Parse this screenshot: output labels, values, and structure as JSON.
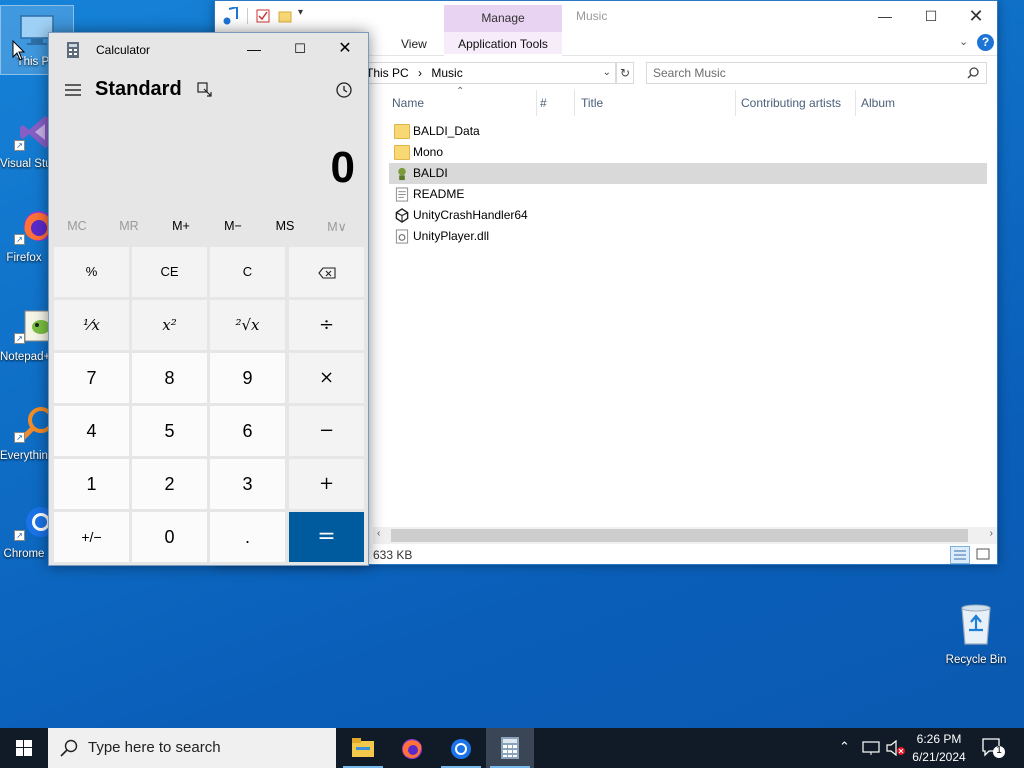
{
  "desktop": {
    "icons": [
      {
        "label": "This PC"
      },
      {
        "label": "Visual Studio 2019"
      },
      {
        "label": "Firefox"
      },
      {
        "label": "Notepad++"
      },
      {
        "label": "Everything"
      },
      {
        "label": "Chrome"
      }
    ],
    "recycle_bin": {
      "label": "Recycle Bin"
    }
  },
  "explorer": {
    "title": "Music",
    "tabs": {
      "manage": "Manage",
      "view": "View",
      "application_tools": "Application Tools"
    },
    "address": {
      "crumbs": [
        "This PC",
        "Music"
      ]
    },
    "search": {
      "placeholder": "Search Music"
    },
    "columns": [
      "Name",
      "#",
      "Title",
      "Contributing artists",
      "Album"
    ],
    "files": [
      {
        "name": "BALDI_Data",
        "type": "folder",
        "selected": false
      },
      {
        "name": "Mono",
        "type": "folder",
        "selected": false
      },
      {
        "name": "BALDI",
        "type": "exe",
        "selected": true
      },
      {
        "name": "README",
        "type": "text",
        "selected": false
      },
      {
        "name": "UnityCrashHandler64",
        "type": "unity",
        "selected": false
      },
      {
        "name": "UnityPlayer.dll",
        "type": "dll",
        "selected": false
      }
    ],
    "status": "633 KB",
    "colors": {
      "accent": "#2b78c5",
      "selected_row": "#d9d9d9",
      "context_tab": "#e9d3f2"
    }
  },
  "calculator": {
    "title": "Calculator",
    "mode": "Standard",
    "display": "0",
    "memory": [
      {
        "label": "MC",
        "enabled": false
      },
      {
        "label": "MR",
        "enabled": false
      },
      {
        "label": "M+",
        "enabled": true
      },
      {
        "label": "M−",
        "enabled": true
      },
      {
        "label": "MS",
        "enabled": true
      },
      {
        "label": "M∨",
        "enabled": false
      }
    ],
    "keys": {
      "percent": "%",
      "ce": "CE",
      "clear": "C",
      "reciprocal": "¹⁄x",
      "square": "x²",
      "sqrt": "²√x",
      "divide": "÷",
      "seven": "7",
      "eight": "8",
      "nine": "9",
      "multiply": "×",
      "four": "4",
      "five": "5",
      "six": "6",
      "minus": "−",
      "one": "1",
      "two": "2",
      "three": "3",
      "plus": "+",
      "negate": "+/−",
      "zero": "0",
      "decimal": ".",
      "equals": "="
    },
    "colors": {
      "equals": "#005a9e",
      "body": "#e6e6e6"
    }
  },
  "taskbar": {
    "search_placeholder": "Type here to search",
    "clock": {
      "time": "6:26 PM",
      "date": "6/21/2024"
    },
    "notification_count": "1"
  }
}
